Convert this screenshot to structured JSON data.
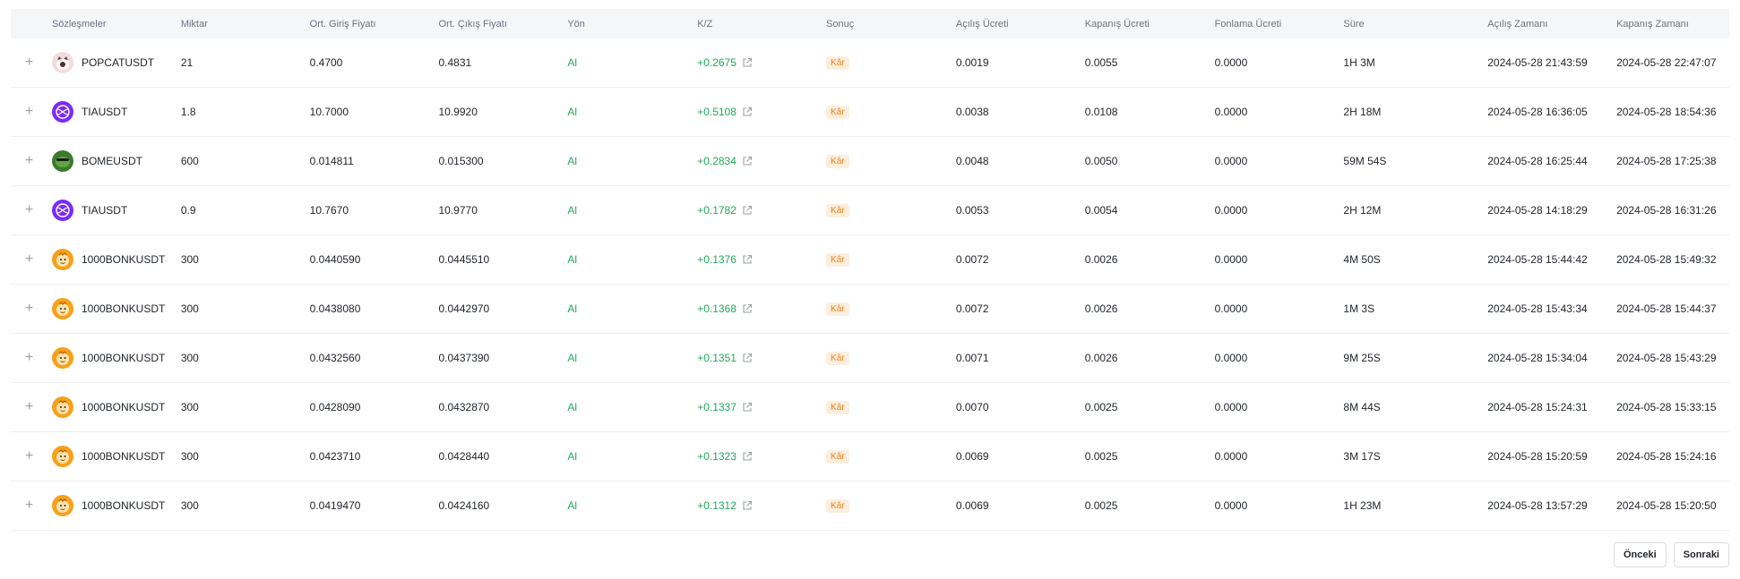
{
  "table": {
    "headers": {
      "symbol": "Sözleşmeler",
      "qty": "Miktar",
      "entry": "Ort. Giriş Fiyatı",
      "exit": "Ort. Çıkış Fiyatı",
      "direction": "Yön",
      "pnl": "K/Z",
      "result": "Sonuç",
      "open_fee": "Açılış Ücreti",
      "close_fee": "Kapanış Ücreti",
      "funding_fee": "Fonlama Ücreti",
      "duration": "Süre",
      "open_time": "Açılış Zamanı",
      "close_time": "Kapanış Zamanı"
    },
    "rows": [
      {
        "icon": "popcat-coin-icon",
        "symbol": "POPCATUSDT",
        "qty": "21",
        "entry": "0.4700",
        "exit": "0.4831",
        "direction": "Al",
        "pnl": "+0.2675",
        "result": "Kâr",
        "open_fee": "0.0019",
        "close_fee": "0.0055",
        "funding_fee": "0.0000",
        "duration": "1H 3M",
        "open_time": "2024-05-28 21:43:59",
        "close_time": "2024-05-28 22:47:07"
      },
      {
        "icon": "tia-coin-icon",
        "symbol": "TIAUSDT",
        "qty": "1.8",
        "entry": "10.7000",
        "exit": "10.9920",
        "direction": "Al",
        "pnl": "+0.5108",
        "result": "Kâr",
        "open_fee": "0.0038",
        "close_fee": "0.0108",
        "funding_fee": "0.0000",
        "duration": "2H 18M",
        "open_time": "2024-05-28 16:36:05",
        "close_time": "2024-05-28 18:54:36"
      },
      {
        "icon": "bome-coin-icon",
        "symbol": "BOMEUSDT",
        "qty": "600",
        "entry": "0.014811",
        "exit": "0.015300",
        "direction": "Al",
        "pnl": "+0.2834",
        "result": "Kâr",
        "open_fee": "0.0048",
        "close_fee": "0.0050",
        "funding_fee": "0.0000",
        "duration": "59M 54S",
        "open_time": "2024-05-28 16:25:44",
        "close_time": "2024-05-28 17:25:38"
      },
      {
        "icon": "tia-coin-icon",
        "symbol": "TIAUSDT",
        "qty": "0.9",
        "entry": "10.7670",
        "exit": "10.9770",
        "direction": "Al",
        "pnl": "+0.1782",
        "result": "Kâr",
        "open_fee": "0.0053",
        "close_fee": "0.0054",
        "funding_fee": "0.0000",
        "duration": "2H 12M",
        "open_time": "2024-05-28 14:18:29",
        "close_time": "2024-05-28 16:31:26"
      },
      {
        "icon": "bonk-coin-icon",
        "symbol": "1000BONKUSDT",
        "qty": "300",
        "entry": "0.0440590",
        "exit": "0.0445510",
        "direction": "Al",
        "pnl": "+0.1376",
        "result": "Kâr",
        "open_fee": "0.0072",
        "close_fee": "0.0026",
        "funding_fee": "0.0000",
        "duration": "4M 50S",
        "open_time": "2024-05-28 15:44:42",
        "close_time": "2024-05-28 15:49:32"
      },
      {
        "icon": "bonk-coin-icon",
        "symbol": "1000BONKUSDT",
        "qty": "300",
        "entry": "0.0438080",
        "exit": "0.0442970",
        "direction": "Al",
        "pnl": "+0.1368",
        "result": "Kâr",
        "open_fee": "0.0072",
        "close_fee": "0.0026",
        "funding_fee": "0.0000",
        "duration": "1M 3S",
        "open_time": "2024-05-28 15:43:34",
        "close_time": "2024-05-28 15:44:37"
      },
      {
        "icon": "bonk-coin-icon",
        "symbol": "1000BONKUSDT",
        "qty": "300",
        "entry": "0.0432560",
        "exit": "0.0437390",
        "direction": "Al",
        "pnl": "+0.1351",
        "result": "Kâr",
        "open_fee": "0.0071",
        "close_fee": "0.0026",
        "funding_fee": "0.0000",
        "duration": "9M 25S",
        "open_time": "2024-05-28 15:34:04",
        "close_time": "2024-05-28 15:43:29"
      },
      {
        "icon": "bonk-coin-icon",
        "symbol": "1000BONKUSDT",
        "qty": "300",
        "entry": "0.0428090",
        "exit": "0.0432870",
        "direction": "Al",
        "pnl": "+0.1337",
        "result": "Kâr",
        "open_fee": "0.0070",
        "close_fee": "0.0025",
        "funding_fee": "0.0000",
        "duration": "8M 44S",
        "open_time": "2024-05-28 15:24:31",
        "close_time": "2024-05-28 15:33:15"
      },
      {
        "icon": "bonk-coin-icon",
        "symbol": "1000BONKUSDT",
        "qty": "300",
        "entry": "0.0423710",
        "exit": "0.0428440",
        "direction": "Al",
        "pnl": "+0.1323",
        "result": "Kâr",
        "open_fee": "0.0069",
        "close_fee": "0.0025",
        "funding_fee": "0.0000",
        "duration": "3M 17S",
        "open_time": "2024-05-28 15:20:59",
        "close_time": "2024-05-28 15:24:16"
      },
      {
        "icon": "bonk-coin-icon",
        "symbol": "1000BONKUSDT",
        "qty": "300",
        "entry": "0.0419470",
        "exit": "0.0424160",
        "direction": "Al",
        "pnl": "+0.1312",
        "result": "Kâr",
        "open_fee": "0.0069",
        "close_fee": "0.0025",
        "funding_fee": "0.0000",
        "duration": "1H 23M",
        "open_time": "2024-05-28 13:57:29",
        "close_time": "2024-05-28 15:20:50"
      }
    ]
  },
  "pager": {
    "prev_label": "Önceki",
    "next_label": "Sonraki"
  },
  "colors": {
    "buy": "#22a85a",
    "profit_badge_text": "#e8821c",
    "profit_badge_bg": "#fdeedd",
    "header_bg": "#f5f6f8"
  },
  "icons": {
    "expand": "plus-icon",
    "pnl_link": "external-link-icon"
  }
}
